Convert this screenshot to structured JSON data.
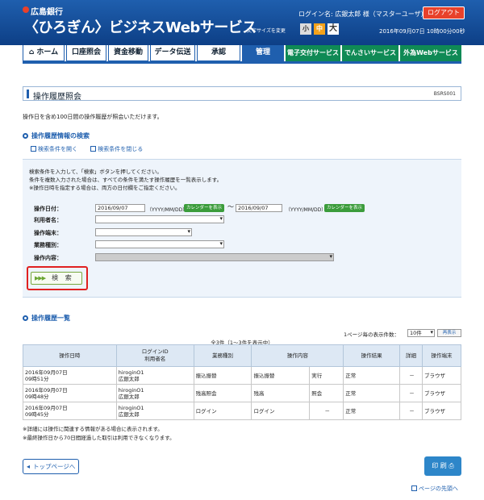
{
  "header": {
    "bank_name": "広島銀行",
    "service_name": "〈ひろぎん〉ビジネスWebサービス",
    "login_info": "ログイン名: 広銀太郎 様（マスターユーザ）",
    "logout_label": "ログアウト",
    "fontsize_label": "文字サイズを変更",
    "fontsize_small": "小",
    "fontsize_mid": "中",
    "fontsize_large": "大",
    "datetime": "2016年09月07日 10時00分00秒"
  },
  "nav": {
    "items": [
      "ホーム",
      "口座照会",
      "資金移動",
      "データ伝送",
      "承認",
      "管理",
      "電子交付サービス",
      "でんさいサービス",
      "外為Webサービス"
    ]
  },
  "page": {
    "title": "操作履歴照会",
    "screen_id": "BSRS001",
    "description": "操作日を含め100日間の操作履歴が照会いただけます。"
  },
  "search": {
    "section_title": "操作履歴情報の検索",
    "open_link": "検索条件を開く",
    "close_link": "検索条件を閉じる",
    "instr1": "検索条件を入力して、「検索」ボタンを押してください。",
    "instr2": "条件を複数入力された場合は、すべての条件を満たす操作履歴を一覧表示します。",
    "instr3": "※操作日時を指定する場合は、両方の日付欄をご指定ください。",
    "label_date": "操作日付：",
    "date_from": "2016/09/07",
    "date_to": "2016/09/07",
    "date_hint": "（YYYY/MM/DD）",
    "calendar_label": "カレンダーを表示",
    "tilde": "〜",
    "label_user": "利用者名：",
    "label_terminal": "操作端末：",
    "label_category": "業務種別：",
    "label_content": "操作内容：",
    "search_label": "検 索",
    "search_arrows": "▶▶▶"
  },
  "results": {
    "section_title": "操作履歴一覧",
    "per_page_label": "1ページ毎の表示件数：",
    "per_page_value": "10件",
    "show_label": "再表示",
    "count_text": "全3件（1〜3件を表示中）",
    "headers": [
      "操作日時",
      "ログインID\n利用者名",
      "業務種別",
      "操作内容",
      "操作結果",
      "詳細",
      "操作端末"
    ],
    "rows": [
      {
        "date": "2016年09月07日",
        "time": "09時51分",
        "login_id": "hiroginO1",
        "user": "広銀太郎",
        "category": "振込振替",
        "content": "振込振替",
        "action": "実行",
        "result": "正常",
        "detail": "－",
        "terminal": "ブラウザ"
      },
      {
        "date": "2016年09月07日",
        "time": "09時48分",
        "login_id": "hiroginO1",
        "user": "広銀太郎",
        "category": "残高照会",
        "content": "残高",
        "action": "照会",
        "result": "正常",
        "detail": "－",
        "terminal": "ブラウザ"
      },
      {
        "date": "2016年09月07日",
        "time": "09時45分",
        "login_id": "hiroginO1",
        "user": "広銀太郎",
        "category": "ログイン",
        "content": "ログイン",
        "action": "－",
        "result": "正常",
        "detail": "－",
        "terminal": "ブラウザ"
      }
    ],
    "note1": "※詳細には操作に関連する情報がある場合に表示されます。",
    "note2": "※最終操作日から70日間経過した取引は利用できなくなります。"
  },
  "footer": {
    "top_label": "トップページへ",
    "print_label": "印 刷",
    "page_top_label": "ページの先頭へ"
  }
}
